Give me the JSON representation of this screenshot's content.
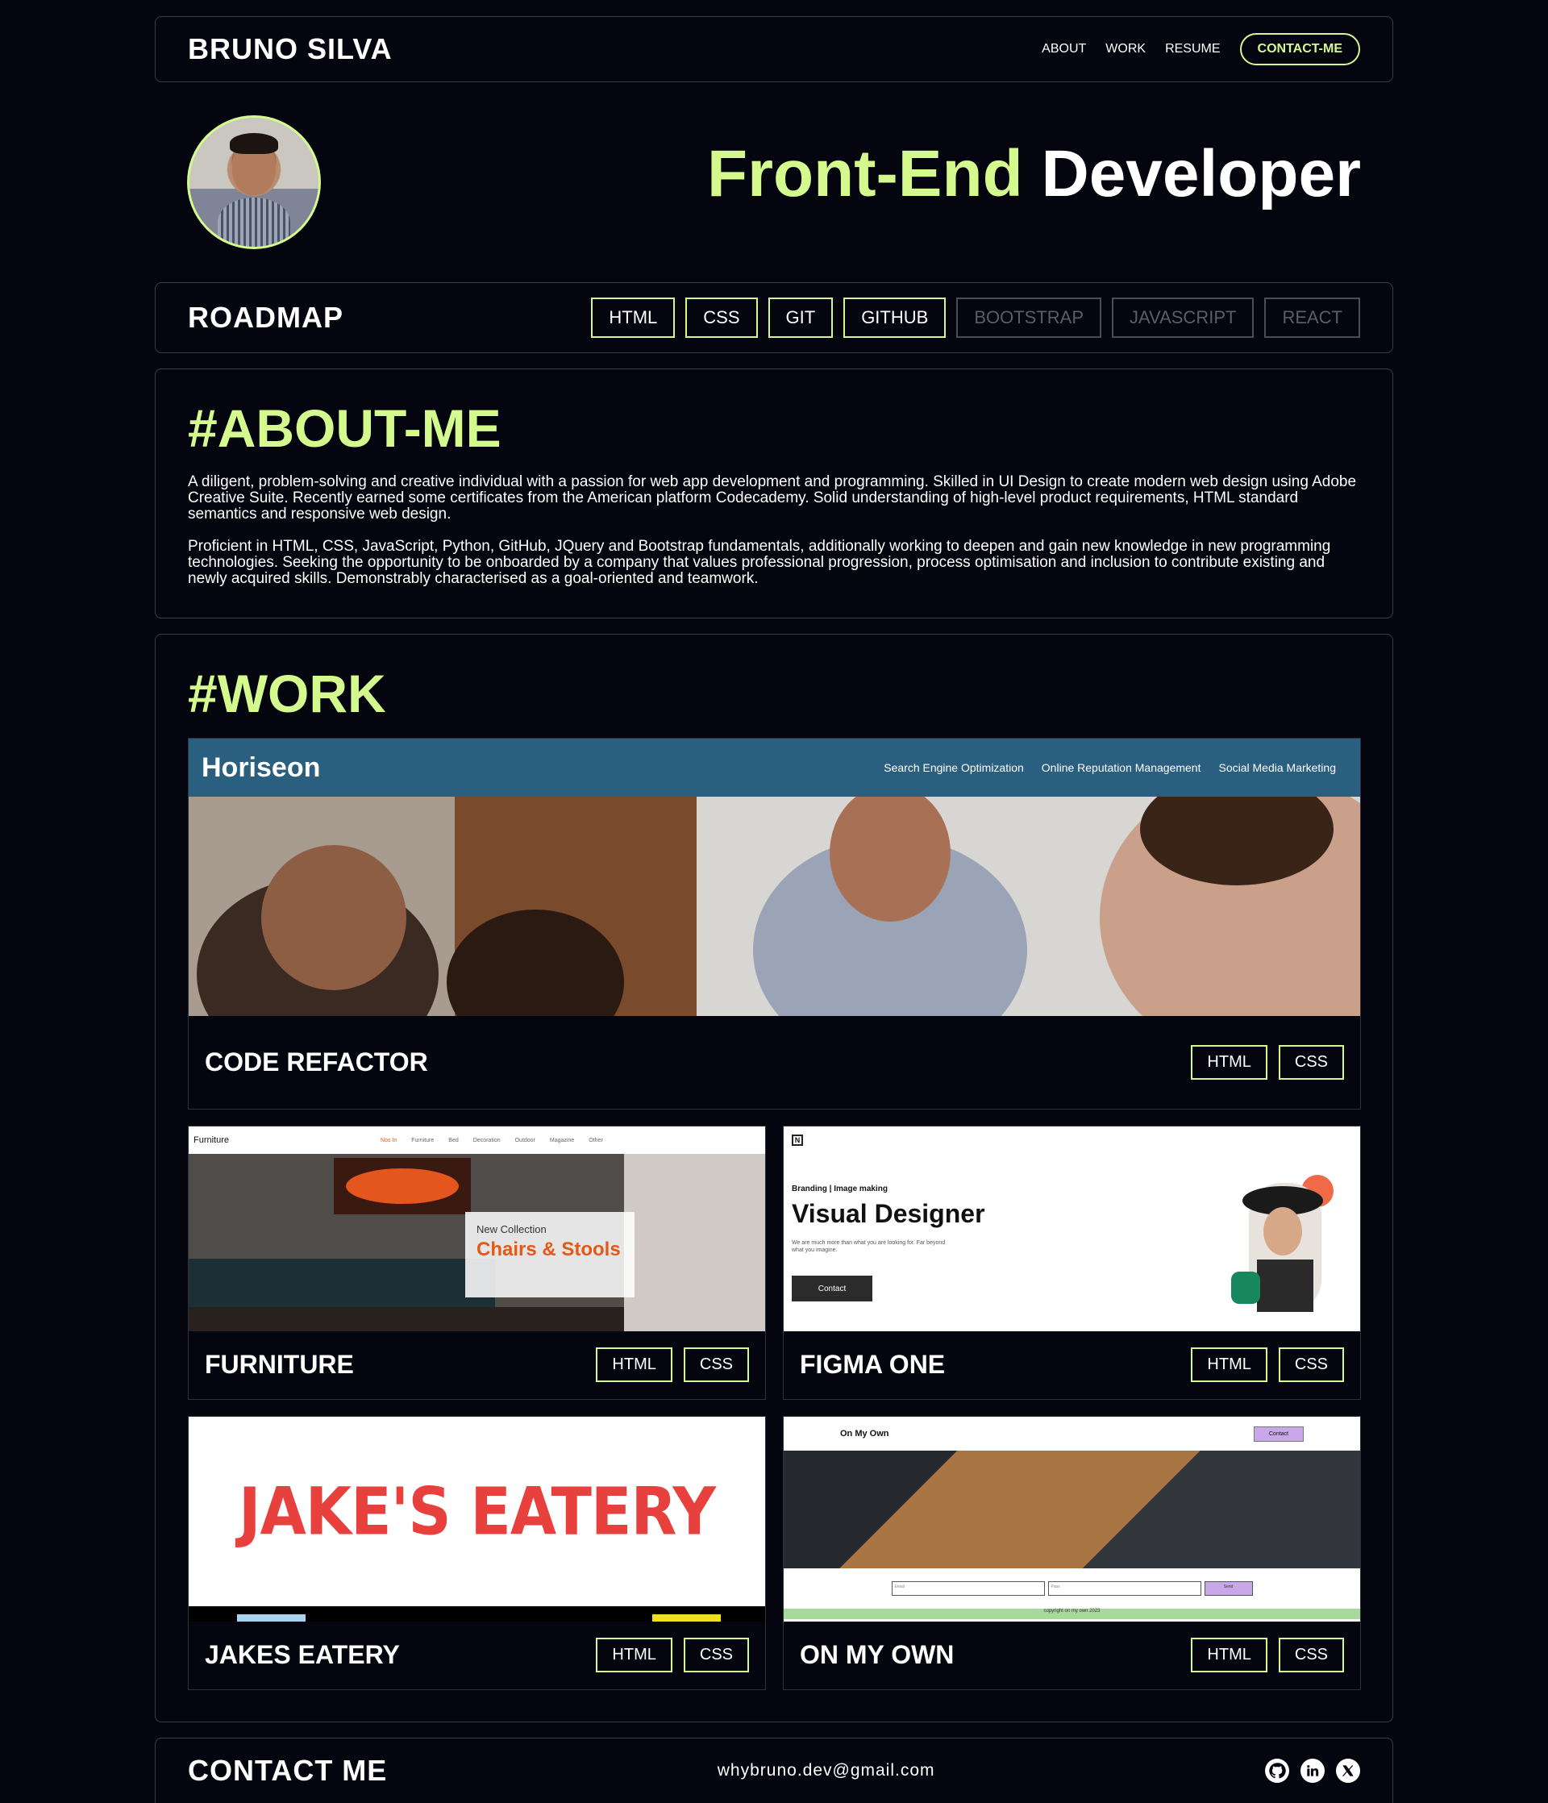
{
  "header": {
    "brand": "BRUNO SILVA",
    "nav": [
      "ABOUT",
      "WORK",
      "RESUME"
    ],
    "contact_label": "CONTACT-ME"
  },
  "hero": {
    "title_accent": "Front-End",
    "title_rest": "Developer"
  },
  "roadmap": {
    "title": "ROADMAP",
    "skills": [
      {
        "label": "HTML",
        "active": true
      },
      {
        "label": "CSS",
        "active": true
      },
      {
        "label": "GIT",
        "active": true
      },
      {
        "label": "GITHUB",
        "active": true
      },
      {
        "label": "BOOTSTRAP",
        "active": false
      },
      {
        "label": "JAVASCRIPT",
        "active": false
      },
      {
        "label": "REACT",
        "active": false
      }
    ]
  },
  "about": {
    "heading": "#ABOUT-ME",
    "paragraphs": [
      "A diligent, problem-solving and creative individual with a passion for web app development and programming. Skilled in UI Design to create modern web design using Adobe Creative Suite. Recently earned some certificates from the American platform Codecademy. Solid understanding of high-level product requirements, HTML standard semantics and responsive web design.",
      "Proficient in HTML, CSS, JavaScript, Python, GitHub, JQuery and Bootstrap fundamentals, additionally working to deepen and gain new knowledge in new programming technologies. Seeking the opportunity to be onboarded by a company that values professional progression, process optimisation and inclusion to contribute existing and newly acquired skills. Demonstrably characterised as a goal-oriented and teamwork."
    ]
  },
  "work": {
    "heading": "#WORK",
    "projects": [
      {
        "name": "CODE REFACTOR",
        "tags": [
          "HTML",
          "CSS"
        ]
      },
      {
        "name": "FURNITURE",
        "tags": [
          "HTML",
          "CSS"
        ]
      },
      {
        "name": "FIGMA ONE",
        "tags": [
          "HTML",
          "CSS"
        ]
      },
      {
        "name": "JAKES EATERY",
        "tags": [
          "HTML",
          "CSS"
        ]
      },
      {
        "name": "ON MY OWN",
        "tags": [
          "HTML",
          "CSS"
        ]
      }
    ],
    "horiseon": {
      "logo": "Horiseon",
      "nav": [
        "Search Engine Optimization",
        "Online Reputation Management",
        "Social Media Marketing"
      ]
    },
    "furniture_preview": {
      "logo": "Furniture",
      "nav": [
        "Nos In",
        "Furniture",
        "Bed",
        "Decoration",
        "Outdoor",
        "Magazine",
        "Other"
      ],
      "collection": "New Collection",
      "headline": "Chairs & Stools"
    },
    "figma_preview": {
      "tagline": "Branding | Image making",
      "title": "Visual Designer",
      "subtitle": "We are much more than what you are looking for. Far beyond what you imagine.",
      "button": "Contact"
    },
    "jakes_preview": {
      "title": "JAKE'S EATERY"
    },
    "omo_preview": {
      "title": "On My Own",
      "button": "Contact",
      "field1": "Email",
      "field2": "Pass",
      "submit": "Send",
      "footer": "copyright on my own 2023"
    }
  },
  "contact": {
    "title": "CONTACT ME",
    "email": "whybruno.dev@gmail.com",
    "socials": [
      "github-icon",
      "linkedin-icon",
      "x-icon"
    ]
  },
  "colors": {
    "accent": "#d4fa8e",
    "background": "#04050f",
    "border": "#3a3d48"
  }
}
